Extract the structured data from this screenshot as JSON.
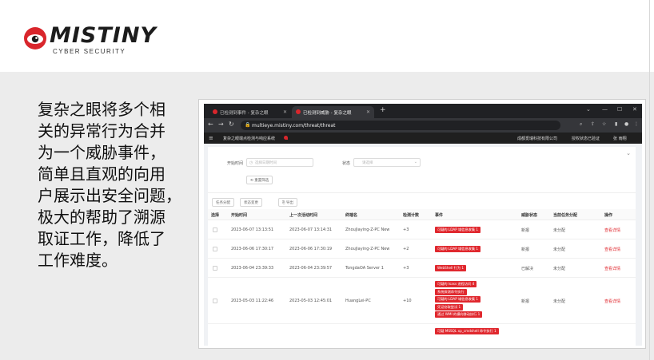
{
  "brand": {
    "name": "MISTINY",
    "tagline": "CYBER SECURITY",
    "red": "#d9262c"
  },
  "description": {
    "lines": [
      "复杂之眼将多个相",
      "关的异常行为合并",
      "为一个威胁事件，",
      "简单且直观的向用",
      "户展示出安全问题，",
      "极大的帮助了溯源",
      "取证工作，降低了",
      "工作难度。"
    ]
  },
  "browser": {
    "tabs": [
      {
        "title": "已检测到事件 - 复杂之眼",
        "active": false
      },
      {
        "title": "已检测到威胁 - 复杂之眼",
        "active": true
      }
    ],
    "url": "multieye.mistiny.com/threat/threat",
    "window_controls": [
      "⌄",
      "—",
      "☐",
      "✕"
    ]
  },
  "app": {
    "product_title": "复杂之眼端点检测与响应系统",
    "org": "成都觅瑞科技有限公司",
    "auth": "授权状态已验证",
    "user": "张 雨翔"
  },
  "filters": {
    "start_time_label": "开始时间",
    "start_time_placeholder": "选择日期时间",
    "status_label": "状态",
    "status_placeholder": "请选择",
    "reset_label": "重置筛选"
  },
  "actions": {
    "assign_label": "任务分配",
    "status_change_label": "状态变更",
    "export_label": "导出"
  },
  "table": {
    "columns": [
      "选择",
      "开始时间",
      "上一次活动时间",
      "终端名",
      "检测计数",
      "事件",
      "威胁状态",
      "当前任务分配",
      "操作"
    ],
    "rows": [
      {
        "start": "2023-06-07 13:13:51",
        "last": "2023-06-07 13:14:31",
        "host": "ZhouJiaying-Z-PC New",
        "count": "+3",
        "events": [
          "可疑的 LDAP 域信息收集 1"
        ],
        "status": "新报",
        "assign": "未分配",
        "op": "查看详情"
      },
      {
        "start": "2023-06-06 17:30:17",
        "last": "2023-06-06 17:30:19",
        "host": "ZhouJiaying-Z-PC New",
        "count": "+2",
        "events": [
          "可疑的 LDAP 域信息收集 1"
        ],
        "status": "新报",
        "assign": "未分配",
        "op": "查看详情"
      },
      {
        "start": "2023-06-04 23:39:33",
        "last": "2023-06-04 23:39:57",
        "host": "TongdaOA Server 1",
        "count": "+3",
        "events": [
          "WebShell 行为 1"
        ],
        "status": "已解决",
        "assign": "未分配",
        "op": "查看详情"
      },
      {
        "start": "2023-05-03 11:22:46",
        "last": "2023-05-03 12:45:01",
        "host": "HuangLei-PC",
        "count": "+10",
        "events": [
          "可疑的 lsass 进程访问 4",
          "系统探测命令执行",
          "可疑的 LDAP 域信息收集 1",
          "凭证窃取尝试 1",
          "通过 WMI 的横向移动执行 1"
        ],
        "status": "新报",
        "assign": "未分配",
        "op": "查看详情"
      },
      {
        "start": "",
        "last": "",
        "host": "",
        "count": "",
        "events": [
          "可疑 MSSQL xp_cmdshell 命令执行 1"
        ],
        "status": "",
        "assign": "",
        "op": ""
      }
    ]
  }
}
